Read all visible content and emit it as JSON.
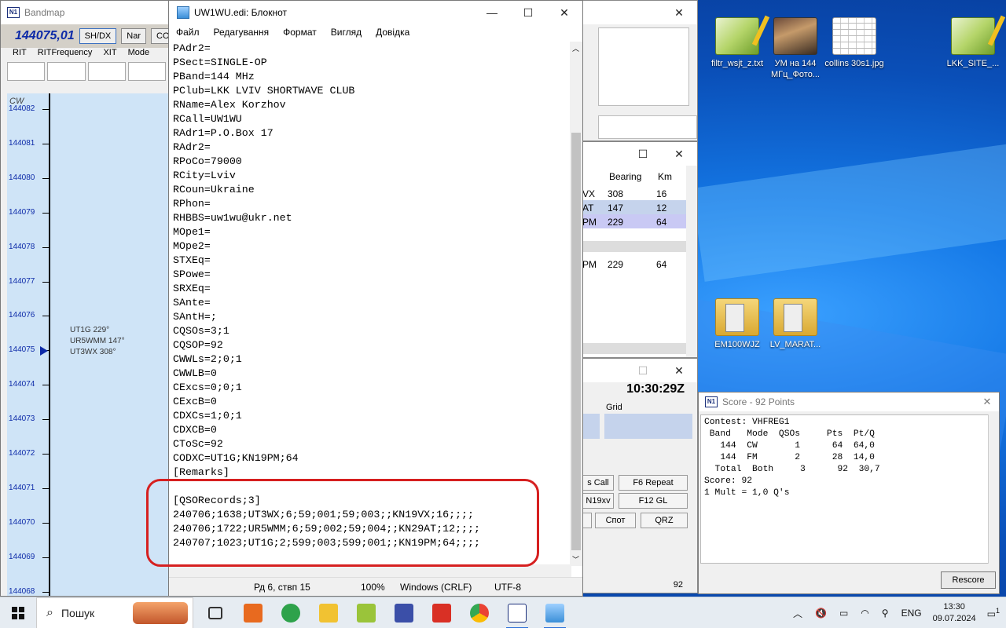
{
  "bandmap": {
    "title": "Bandmap",
    "frequency": "144075,01",
    "buttons": [
      "SH/DX",
      "Nar",
      "CO"
    ],
    "labels": [
      "RIT",
      "RITFrequency",
      "XIT",
      "Mode"
    ],
    "mode": "CW",
    "ticks": [
      "144082",
      "144081",
      "144080",
      "144079",
      "144078",
      "144077",
      "144076",
      "144075",
      "144074",
      "144073",
      "144072",
      "144071",
      "144070",
      "144069",
      "144068"
    ],
    "spots": [
      "UT1G 229°",
      "UR5WMM 147°",
      "UT3WX 308°"
    ]
  },
  "notepad": {
    "title": "UW1WU.edi: Блокнот",
    "menu": [
      "Файл",
      "Редагування",
      "Формат",
      "Вигляд",
      "Довідка"
    ],
    "lines": [
      "PAdr2=",
      "PSect=SINGLE-OP",
      "PBand=144 MHz",
      "PClub=LKK LVIV SHORTWAVE CLUB",
      "RName=Alex Korzhov",
      "RCall=UW1WU",
      "RAdr1=P.O.Box 17",
      "RAdr2=",
      "RPoCo=79000",
      "RCity=Lviv",
      "RCoun=Ukraine",
      "RPhon=",
      "RHBBS=uw1wu@ukr.net",
      "MOpe1=",
      "MOpe2=",
      "STXEq=",
      "SPowe=",
      "SRXEq=",
      "SAnte=",
      "SAntH=;",
      "CQSOs=3;1",
      "CQSOP=92",
      "CWWLs=2;0;1",
      "CWWLB=0",
      "CExcs=0;0;1",
      "CExcB=0",
      "CDXCs=1;0;1",
      "CDXCB=0",
      "CToSc=92",
      "CODXC=UT1G;KN19PM;64",
      "[Remarks]",
      "",
      "[QSORecords;3]",
      "240706;1638;UT3WX;6;59;001;59;003;;KN19VX;16;;;;",
      "240706;1722;UR5WMM;6;59;002;59;004;;KN29AT;12;;;;",
      "240707;1023;UT1G;2;599;003;599;001;;KN19PM;64;;;;"
    ],
    "status": {
      "position": "Рд 6, ствп 15",
      "zoom": "100%",
      "eol": "Windows (CRLF)",
      "encoding": "UTF-8"
    }
  },
  "log_window": {
    "headers": [
      "Bearing",
      "Km"
    ],
    "rows": [
      {
        "call": "VX",
        "bearing": "308",
        "km": "16"
      },
      {
        "call": "AT",
        "bearing": "147",
        "km": "12"
      },
      {
        "call": "PM",
        "bearing": "229",
        "km": "64"
      }
    ],
    "second_row": {
      "call": "PM",
      "bearing": "229",
      "km": "64"
    }
  },
  "entry_window": {
    "time": "10:30:29Z",
    "grid_label": "Grid",
    "buttons": [
      "s Call",
      "F6 Repeat",
      "N19xv",
      "F12 GL",
      "Спот",
      "QRZ"
    ],
    "count": "92"
  },
  "score": {
    "title": "Score - 92 Points",
    "lines": [
      "Contest: VHFREG1",
      " Band   Mode  QSOs     Pts  Pt/Q",
      "   144  CW       1      64  64,0",
      "   144  FM       2      28  14,0",
      "  Total  Both     3      92  30,7",
      "Score: 92",
      "1 Mult = 1,0 Q's"
    ],
    "rescore": "Rescore"
  },
  "desktop_icons": [
    {
      "label": "filtr_wsjt_z.txt",
      "icon": "notepadpp-icon"
    },
    {
      "label": "УМ на 144 МГц_Фото...",
      "icon": "photo-icon"
    },
    {
      "label": "collins 30s1.jpg",
      "icon": "image-icon"
    },
    {
      "label": "LKK_SITE_...",
      "icon": "notepadpp-icon"
    },
    {
      "label": "EM100WJZ",
      "icon": "folder-icon"
    },
    {
      "label": "LV_MARAT...",
      "icon": "folder-icon"
    }
  ],
  "taskbar": {
    "search_placeholder": "Пошук",
    "lang": "ENG",
    "time": "13:30",
    "date": "09.07.2024",
    "notifications": "1"
  }
}
